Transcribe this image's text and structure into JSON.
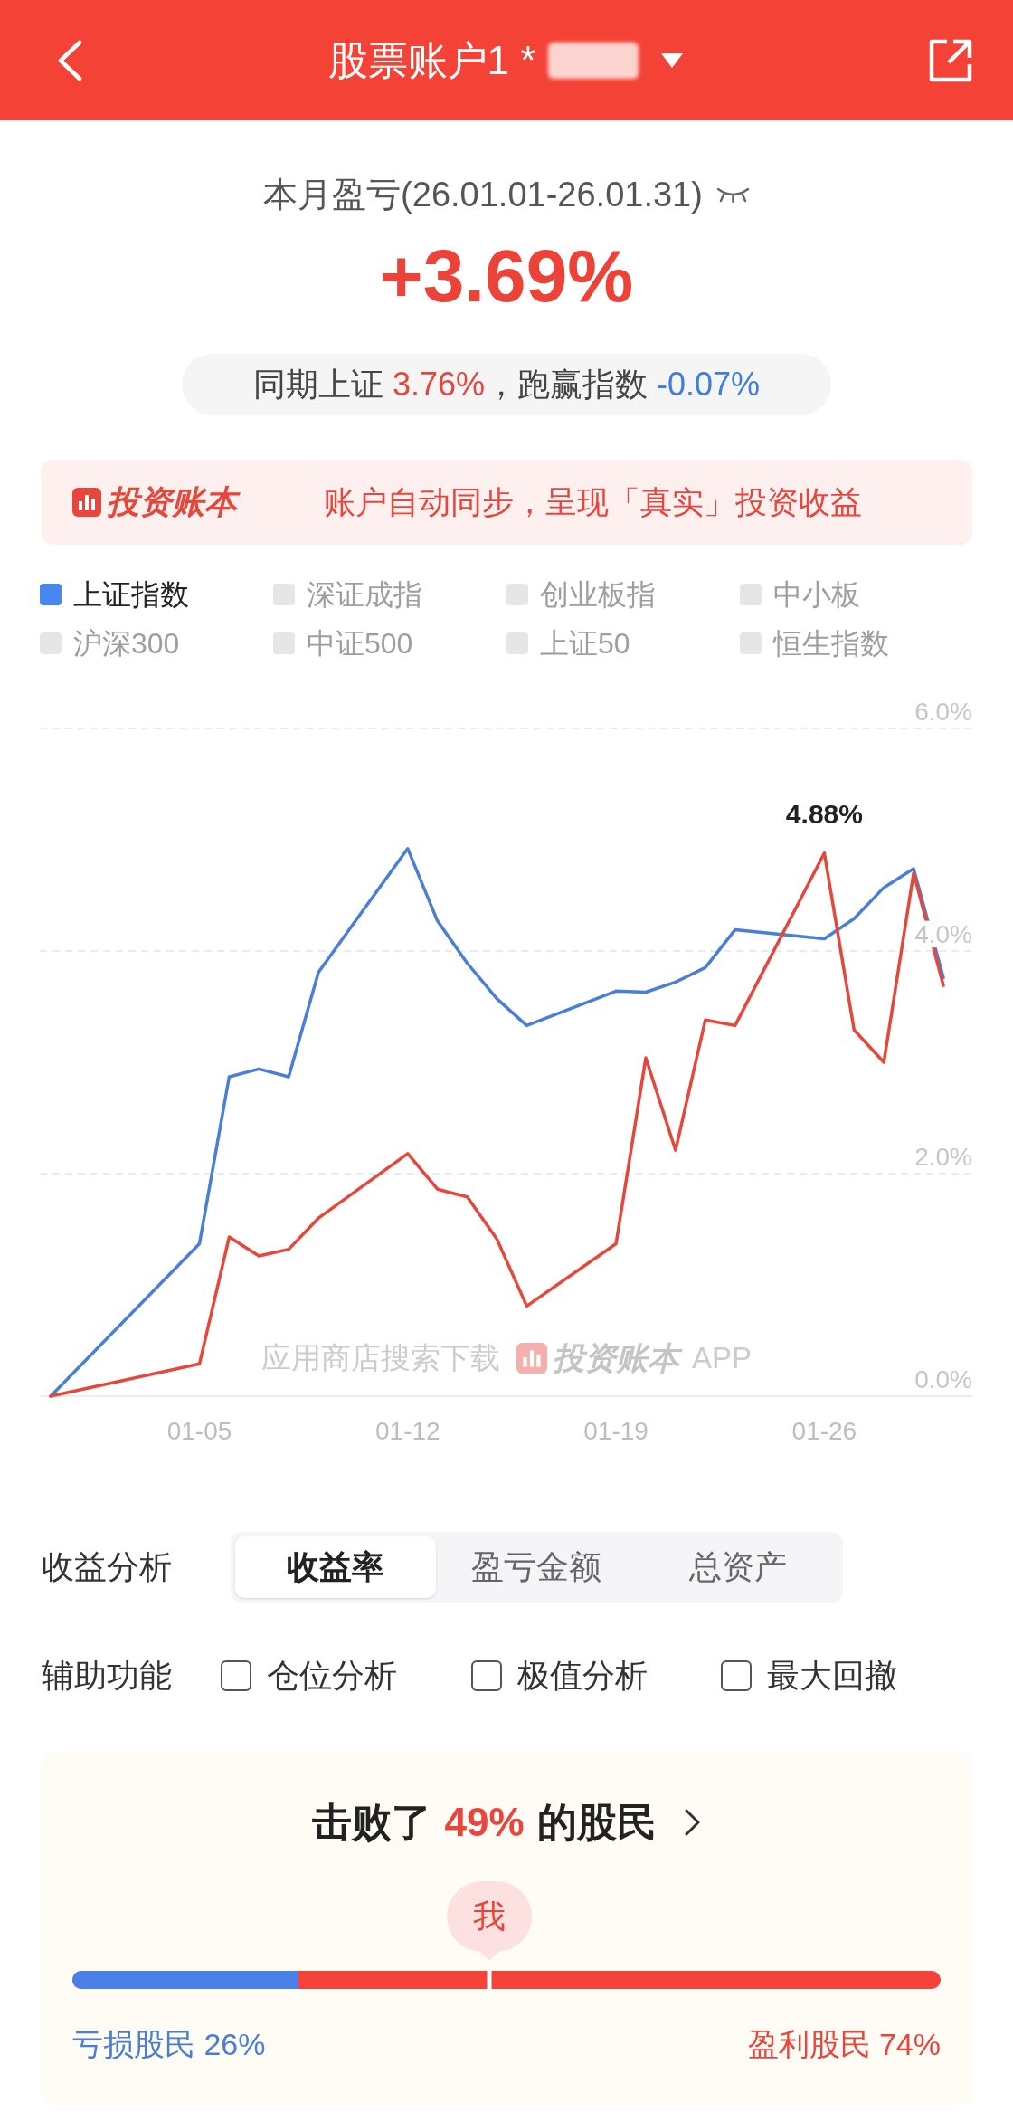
{
  "header": {
    "title": "股票账户1 *",
    "masked": true
  },
  "summary": {
    "period_label": "本月盈亏(26.01.01-26.01.31)",
    "return": "+3.69%",
    "comparison": [
      {
        "text": "同期上证",
        "kind": "label"
      },
      {
        "text": "3.76%",
        "kind": "gain"
      },
      {
        "text": "，跑赢指数",
        "kind": "label"
      },
      {
        "text": "-0.07%",
        "kind": "loss"
      }
    ]
  },
  "banner": {
    "brand": "投资账本",
    "message": "账户自动同步，呈现「真实」投资收益"
  },
  "legend": [
    {
      "label": "上证指数",
      "selected": true
    },
    {
      "label": "深证成指",
      "selected": false
    },
    {
      "label": "创业板指",
      "selected": false
    },
    {
      "label": "中小板",
      "selected": false
    },
    {
      "label": "沪深300",
      "selected": false
    },
    {
      "label": "中证500",
      "selected": false
    },
    {
      "label": "上证50",
      "selected": false
    },
    {
      "label": "恒生指数",
      "selected": false
    }
  ],
  "chart": {
    "promo": {
      "prefix": "应用商店搜索下载",
      "brand": "投资账本",
      "suffix": "APP"
    },
    "chart_data": {
      "type": "line",
      "categories": [
        null,
        null,
        null,
        null,
        null,
        "01-05",
        null,
        null,
        null,
        null,
        null,
        null,
        "01-12",
        null,
        null,
        null,
        null,
        null,
        null,
        "01-19",
        null,
        null,
        null,
        null,
        null,
        null,
        "01-26",
        null,
        null,
        null,
        null
      ],
      "ylim": [
        0,
        6
      ],
      "yticks": [
        {
          "value": 0,
          "label": "0.0%"
        },
        {
          "value": 2,
          "label": "2.0%"
        },
        {
          "value": 4,
          "label": "4.0%"
        },
        {
          "value": 6,
          "label": "6.0%"
        }
      ],
      "series": [
        {
          "color": "#4a7fd8",
          "values": [
            0,
            null,
            null,
            null,
            null,
            1.37,
            2.87,
            2.94,
            2.87,
            3.81,
            null,
            null,
            4.92,
            4.27,
            3.89,
            3.57,
            3.33,
            null,
            null,
            3.64,
            3.63,
            3.72,
            3.85,
            4.19,
            null,
            null,
            4.11,
            4.29,
            4.57,
            4.74,
            3.76
          ]
        },
        {
          "color": "#e5483b",
          "values": [
            0,
            null,
            null,
            null,
            null,
            0.29,
            1.43,
            1.26,
            1.32,
            1.6,
            null,
            null,
            2.18,
            1.86,
            1.79,
            1.41,
            0.81,
            null,
            null,
            1.37,
            3.04,
            2.21,
            3.38,
            3.33,
            null,
            null,
            4.88,
            3.29,
            3.0,
            4.7,
            3.69
          ]
        }
      ],
      "annotations": [
        {
          "y": 4.88,
          "text": "4.88%"
        }
      ]
    }
  },
  "analysis": {
    "label": "收益分析",
    "tabs": [
      {
        "label": "收益率",
        "selected": true
      },
      {
        "label": "盈亏金额",
        "selected": false
      },
      {
        "label": "总资产",
        "selected": false
      }
    ]
  },
  "tools": {
    "label": "辅助功能",
    "options": [
      {
        "label": "仓位分析",
        "checked": false
      },
      {
        "label": "极值分析",
        "checked": false
      },
      {
        "label": "最大回撤",
        "checked": false
      }
    ]
  },
  "ranking": {
    "title": [
      {
        "text": "击败了",
        "kind": "label"
      },
      {
        "text": "49%",
        "kind": "gain"
      },
      {
        "text": "的股民",
        "kind": "label"
      }
    ],
    "marker": {
      "label": "我",
      "level": 0.48
    },
    "bar": {
      "level": 0.26
    },
    "loss_label": "亏损股民 26%",
    "gain_label": "盈利股民 74%"
  }
}
